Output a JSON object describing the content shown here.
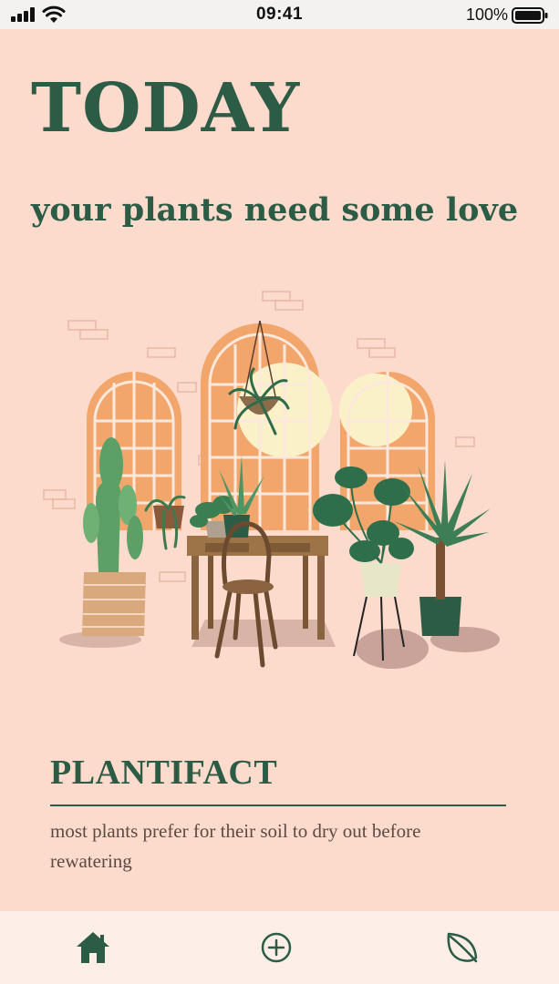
{
  "status_bar": {
    "time": "09:41",
    "battery_percent": "100%",
    "icons": [
      "signal-icon",
      "wifi-icon",
      "battery-icon"
    ]
  },
  "header": {
    "title": "TODAY",
    "subtitle": "your plants need some love"
  },
  "plantifact": {
    "title": "PLANTIFACT",
    "text": "most plants prefer for their soil to dry out before rewatering"
  },
  "tabbar": {
    "items": [
      {
        "icon": "home-icon",
        "active": true
      },
      {
        "icon": "add-circle-icon",
        "active": false
      },
      {
        "icon": "leaf-icon",
        "active": false
      }
    ]
  },
  "colors": {
    "background": "#fddbcc",
    "accent_green": "#2d5c46",
    "window_orange": "#f2a66c",
    "tabbar": "#fdeee7"
  }
}
